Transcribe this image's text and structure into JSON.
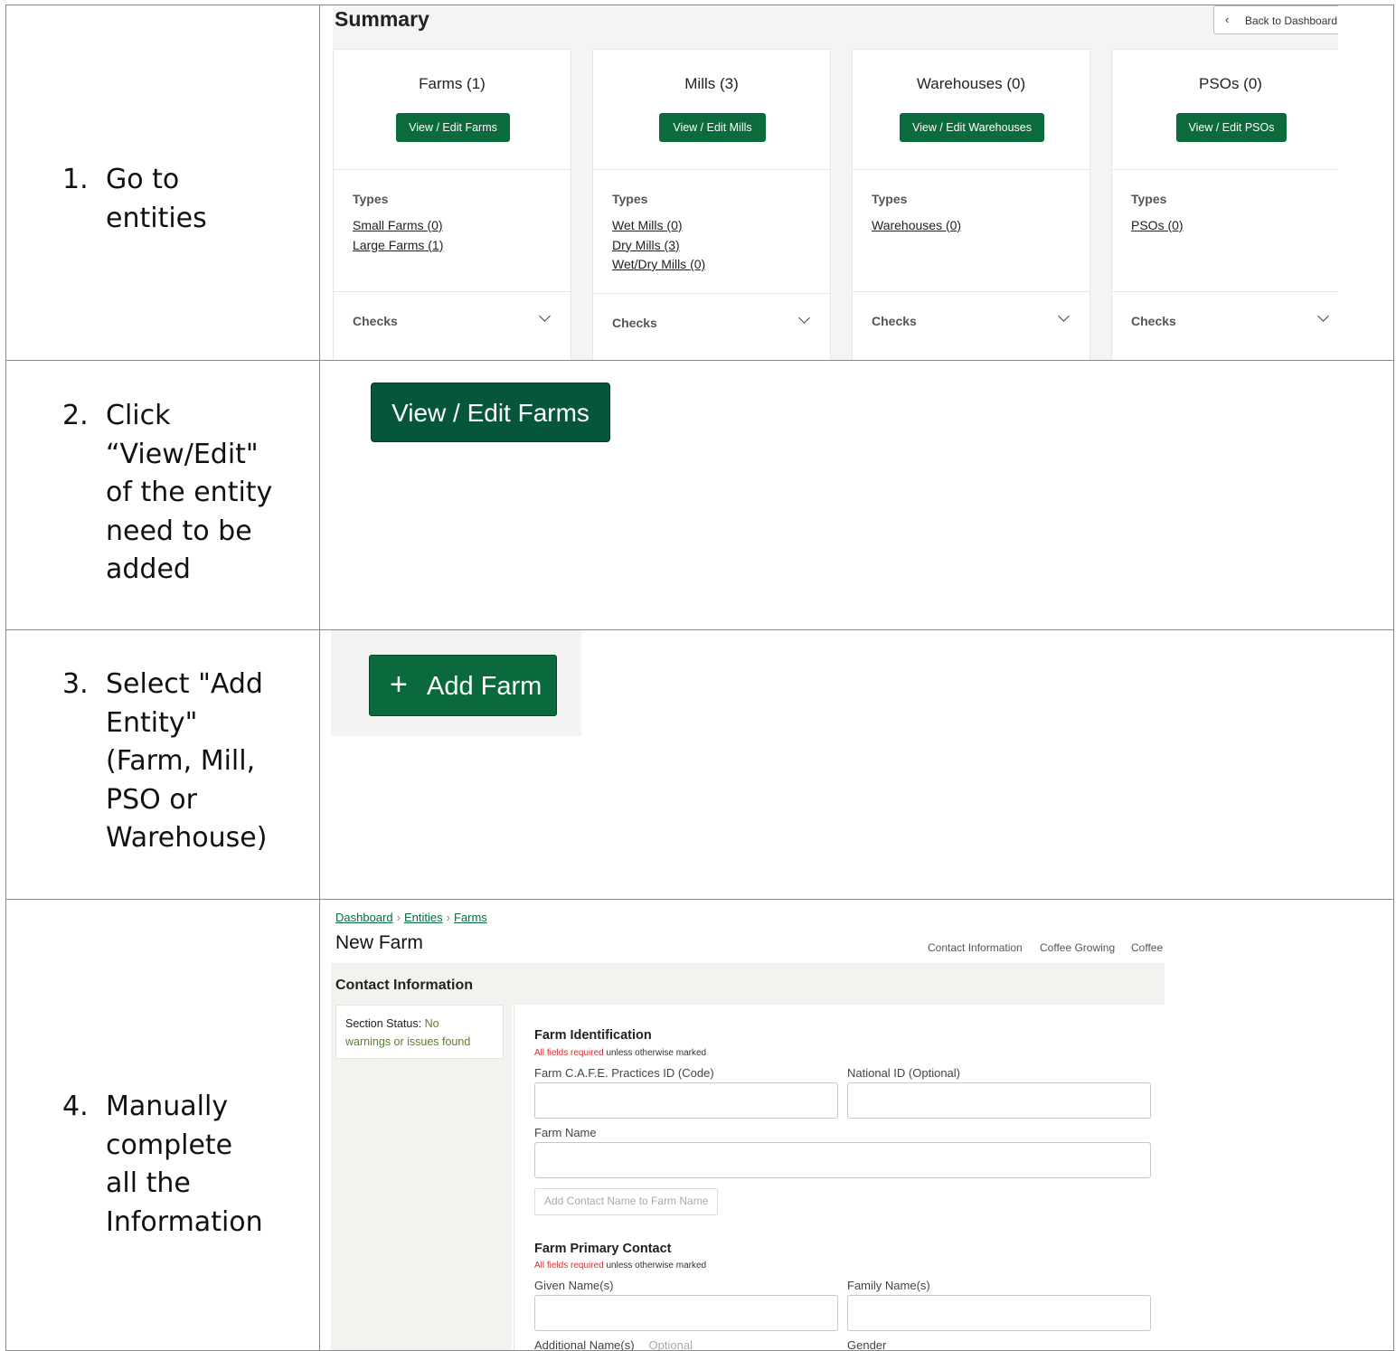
{
  "steps": [
    {
      "num": "1.",
      "lines": [
        "Go to",
        "entities"
      ]
    },
    {
      "num": "2.",
      "lines": [
        "Click",
        "“View/Edit\"",
        "of the entity",
        "need to be",
        "added"
      ]
    },
    {
      "num": "3.",
      "lines": [
        "Select \"Add",
        "Entity\"",
        "(Farm, Mill,",
        "PSO or",
        "Warehouse)"
      ]
    },
    {
      "num": "4.",
      "lines": [
        "Manually",
        "complete",
        "all the",
        "Information"
      ]
    }
  ],
  "summary": {
    "title": "Summary",
    "back_label": "Back to Dashboard",
    "types_heading": "Types",
    "checks_label": "Checks",
    "cards": [
      {
        "title": "Farms (1)",
        "button": "View / Edit Farms",
        "links": [
          "Small Farms (0)",
          "Large Farms (1)"
        ]
      },
      {
        "title": "Mills (3)",
        "button": "View / Edit Mills",
        "links": [
          "Wet Mills (0)",
          "Dry Mills (3)",
          "Wet/Dry Mills (0)"
        ]
      },
      {
        "title": "Warehouses (0)",
        "button": "View / Edit Warehouses",
        "links": [
          "Warehouses (0)"
        ]
      },
      {
        "title": "PSOs (0)",
        "button": "View / Edit PSOs",
        "links": [
          "PSOs (0)"
        ]
      }
    ]
  },
  "step2_button": "View / Edit Farms",
  "step3_button": {
    "icon": "plus-icon",
    "label": "Add Farm"
  },
  "form": {
    "breadcrumb": [
      "Dashboard",
      "Entities",
      "Farms"
    ],
    "title": "New Farm",
    "section_nav": [
      "Contact Information",
      "Coffee Growing",
      "Coffee"
    ],
    "section_header": "Contact Information",
    "status_label": "Section Status:",
    "status_value_part1": "No",
    "status_value_part2": "warnings or issues found",
    "required_red": "All fields required",
    "required_rest": "unless otherwise marked",
    "farm_identification": {
      "title": "Farm Identification",
      "cafe_id_label": "Farm C.A.F.E. Practices ID (Code)",
      "cafe_id_value": "",
      "national_id_label": "National ID (Optional)",
      "national_id_value": "",
      "farm_name_label": "Farm Name",
      "farm_name_value": "",
      "add_contact_button": "Add Contact Name to Farm Name"
    },
    "primary_contact": {
      "title": "Farm Primary Contact",
      "given_label": "Given Name(s)",
      "given_value": "",
      "family_label": "Family Name(s)",
      "family_value": "",
      "additional_label": "Additional Name(s)",
      "additional_optional": "Optional",
      "gender_label": "Gender"
    }
  },
  "colors": {
    "brand_green": "#0c6b3c",
    "link_green": "#0b6b3a",
    "required_red": "#d03030"
  }
}
